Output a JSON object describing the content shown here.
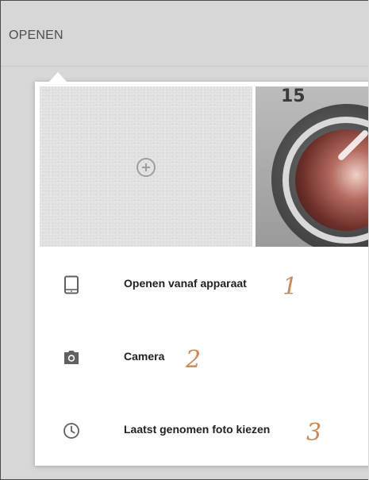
{
  "header": {
    "title": "OPENEN"
  },
  "thumbnails": {
    "placeholder": {
      "icon": "add-circle-icon",
      "caption": ""
    },
    "photo": {
      "number": "15",
      "subject": "washing-machine-drum"
    }
  },
  "menu": {
    "items": [
      {
        "label": "Openen vanaf apparaat",
        "icon": "tablet-icon",
        "annotation": "1"
      },
      {
        "label": "Camera",
        "icon": "camera-icon",
        "annotation": "2"
      },
      {
        "label": "Laatst genomen foto kiezen",
        "icon": "clock-icon",
        "annotation": "3"
      }
    ]
  },
  "colors": {
    "background": "#d7d7d7",
    "popup": "#ffffff",
    "text": "#212121",
    "icon": "#616161",
    "annotation": "#c98a5a"
  }
}
